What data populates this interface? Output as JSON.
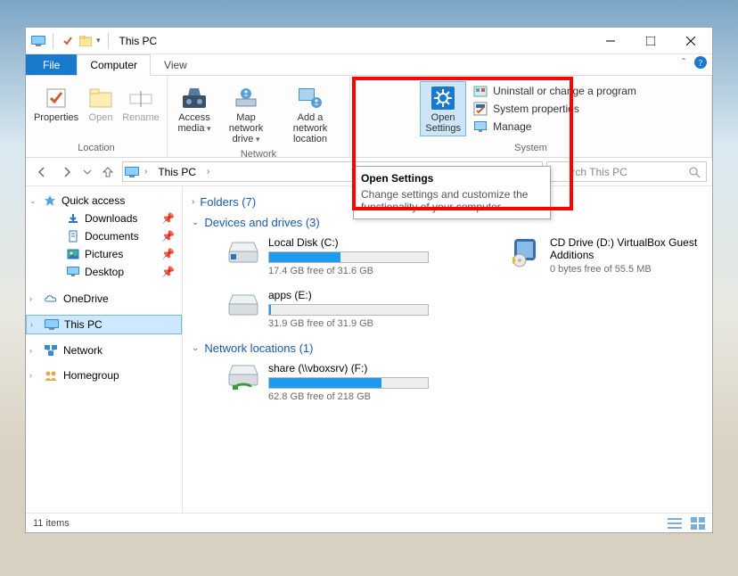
{
  "titlebar": {
    "title": "This PC"
  },
  "tabs": {
    "file": "File",
    "computer": "Computer",
    "view": "View"
  },
  "ribbon": {
    "location": {
      "label": "Location",
      "properties": "Properties",
      "open": "Open",
      "rename": "Rename"
    },
    "network": {
      "label": "Network",
      "access_media": "Access media",
      "map_drive": "Map network drive",
      "add_loc": "Add a network location"
    },
    "system": {
      "label": "System",
      "open_settings": "Open Settings",
      "uninstall": "Uninstall or change a program",
      "sys_props": "System properties",
      "manage": "Manage"
    }
  },
  "nav": {
    "address": "This PC",
    "search_placeholder": "Search This PC"
  },
  "sidebar": {
    "quick_access": "Quick access",
    "downloads": "Downloads",
    "documents": "Documents",
    "pictures": "Pictures",
    "desktop": "Desktop",
    "onedrive": "OneDrive",
    "this_pc": "This PC",
    "network": "Network",
    "homegroup": "Homegroup"
  },
  "content": {
    "folders_head": "Folders (7)",
    "devices_head": "Devices and drives (3)",
    "netloc_head": "Network locations (1)",
    "local_c": {
      "name": "Local Disk (C:)",
      "stat": "17.4 GB free of 31.6 GB",
      "fill_pct": 45
    },
    "cd_d": {
      "name": "CD Drive (D:) VirtualBox Guest Additions",
      "stat": "0 bytes free of 55.5 MB"
    },
    "apps_e": {
      "name": "apps (E:)",
      "stat": "31.9 GB free of 31.9 GB",
      "fill_pct": 1
    },
    "share_f": {
      "name": "share (\\\\vboxsrv) (F:)",
      "stat": "62.8 GB free of 218 GB",
      "fill_pct": 71
    }
  },
  "statusbar": {
    "items": "11 items"
  },
  "tooltip": {
    "title": "Open Settings",
    "body": "Change settings and customize the functionality of your computer."
  }
}
